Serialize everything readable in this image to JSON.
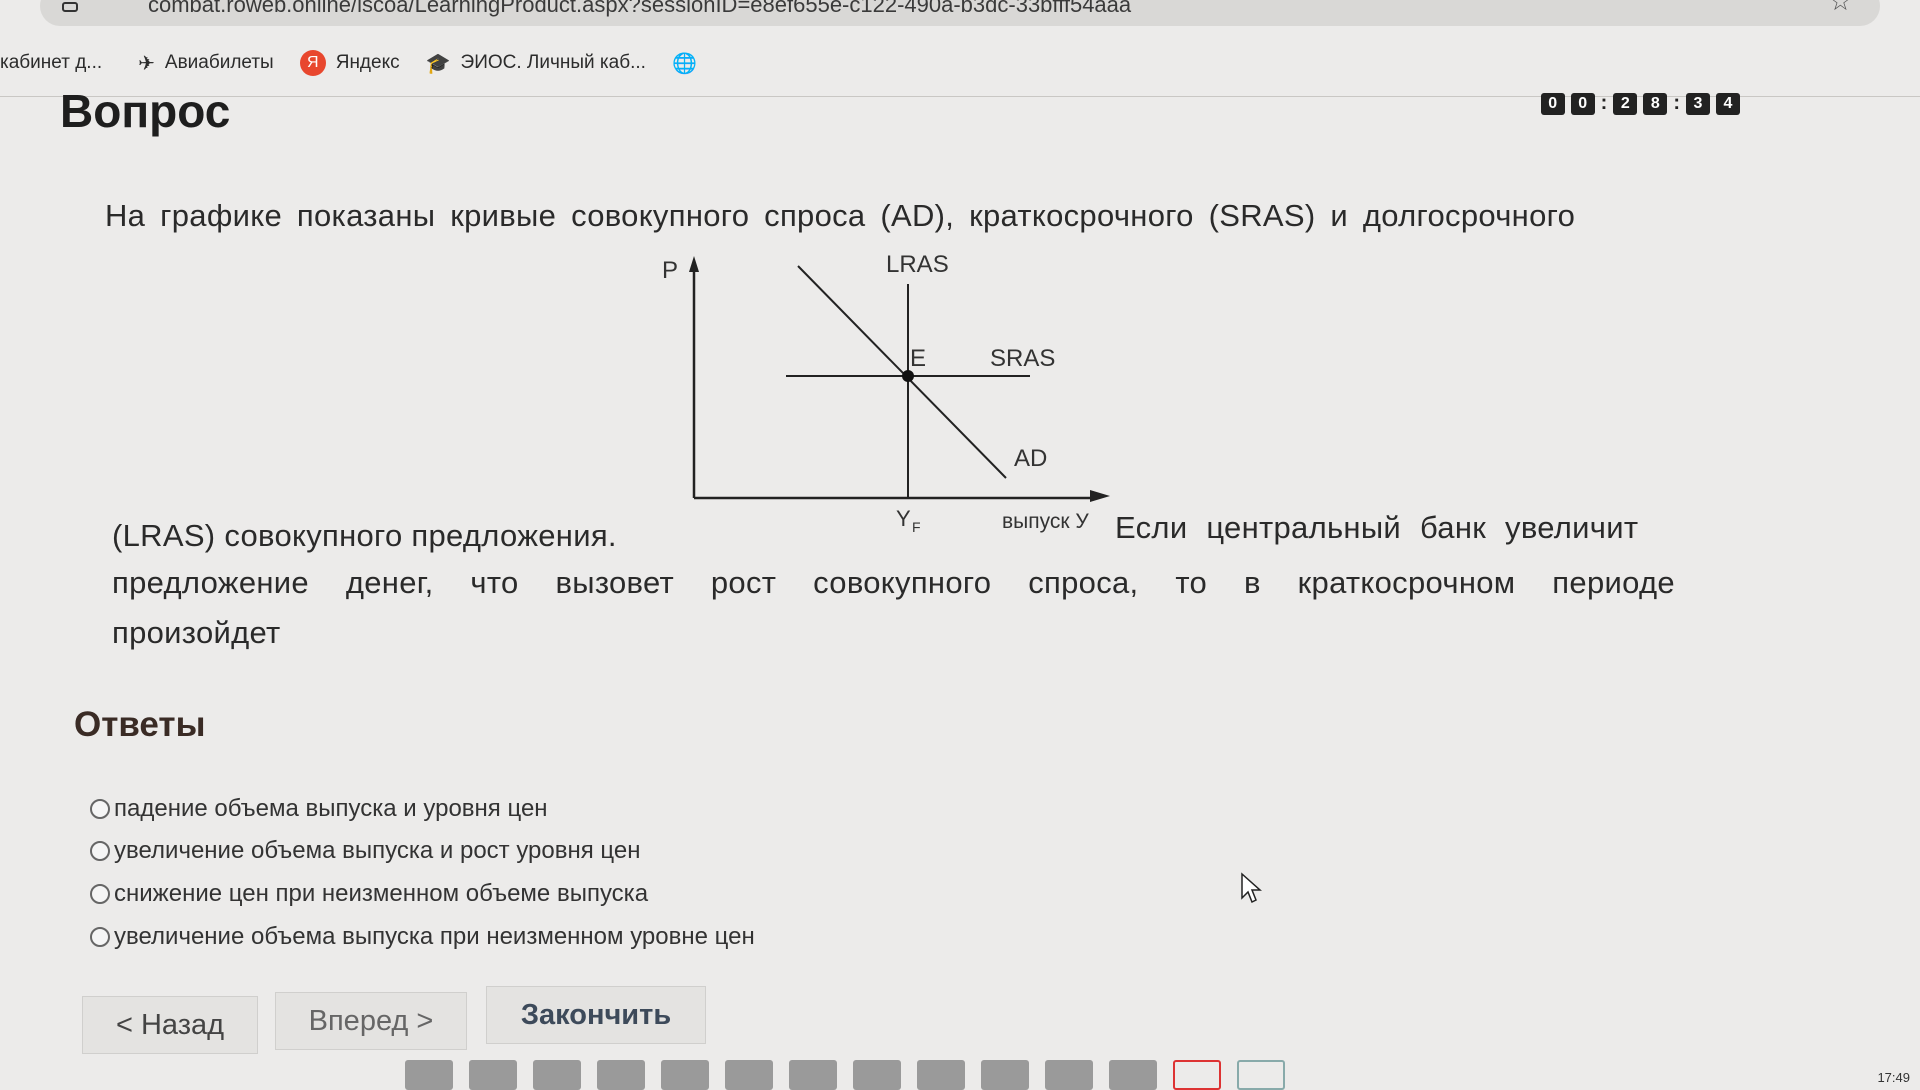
{
  "browser": {
    "url": "combat.roweb.online/iscoa/LearningProduct.aspx?sessionID=e8ef655e-c122-490a-b3dc-33bfff54aaa",
    "bookmarks": [
      {
        "label": "кабинет д...",
        "icon": "cabinet-icon"
      },
      {
        "label": "Авиабилеты",
        "icon": "airplane-icon"
      },
      {
        "label": "Яндекс",
        "icon": "yandex-icon"
      },
      {
        "label": "ЭИОС. Личный каб...",
        "icon": "graduation-cap-icon"
      },
      {
        "label": "",
        "icon": "globe-icon"
      }
    ]
  },
  "page": {
    "title": "Вопрос",
    "timer": [
      "0",
      "0",
      ":",
      "2",
      "8",
      ":",
      "3",
      "4"
    ]
  },
  "question": {
    "line1": "На графике показаны кривые совокупного спроса (AD), краткосрочного (SRAS) и долгосрочного",
    "line2": "(LRAS) совокупного предложения.",
    "line3": "Если центральный банк увеличит",
    "line4": "предложение денег, что вызовет рост совокупного спроса, то в краткосрочном периоде",
    "line5": "произойдет"
  },
  "graph": {
    "axis_y": "P",
    "axis_x": "выпуск У",
    "lras": "LRAS",
    "sras": "SRAS",
    "ad": "AD",
    "point": "E",
    "yf_main": "Y",
    "yf_sub": "F"
  },
  "answers": {
    "title": "Ответы",
    "options": [
      "падение объема выпуска и уровня цен",
      "увеличение объема выпуска и рост уровня цен",
      "снижение цен при неизменном объеме выпуска",
      "увеличение объема выпуска при неизменном уровне цен"
    ]
  },
  "nav": {
    "back": "< Назад",
    "forward": "Вперед >",
    "finish": "Закончить"
  },
  "clock": "17:49"
}
